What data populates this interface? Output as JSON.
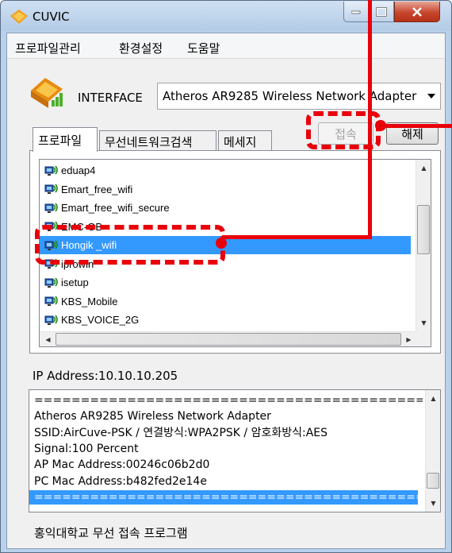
{
  "window": {
    "title": "CUVIC"
  },
  "menu": [
    "프로파일관리",
    "환경설정",
    "도움말"
  ],
  "interface": {
    "label": "INTERFACE",
    "selected": "Atheros AR9285 Wireless Network Adapter"
  },
  "tabs": [
    "프로파일",
    "무선네트워크검색",
    "메세지"
  ],
  "buttons": {
    "connect": "접속",
    "disconnect": "해제"
  },
  "networks": [
    "eduap4",
    "Emart_free_wifi",
    "Emart_free_wifi_secure",
    "EMC-GB",
    "Hongik _wifi",
    "iprowin",
    "isetup",
    "KBS_Mobile",
    "KBS_VOICE_2G"
  ],
  "selected_network": "Hongik _wifi",
  "ip_address": "IP Address:10.10.10.205",
  "log": [
    "==========================================",
    "Atheros AR9285 Wireless Network Adapter",
    "SSID:AirCuve-PSK / 연결방식:WPA2PSK / 암호화방식:AES",
    "Signal:100 Percent",
    "AP Mac Address:00246c06b2d0",
    "PC Mac Address:b482fed2e14e",
    "=========================================="
  ],
  "footer": "홍익대학교 무선 접속 프로그램",
  "colors": {
    "accent": "#e8000b",
    "selection": "#3399ff",
    "frame": "#b9d1ea"
  },
  "icons": {
    "app": "cuvic-logo-icon",
    "network": "wireless-network-icon",
    "dropdown": "chevron-down-icon"
  }
}
